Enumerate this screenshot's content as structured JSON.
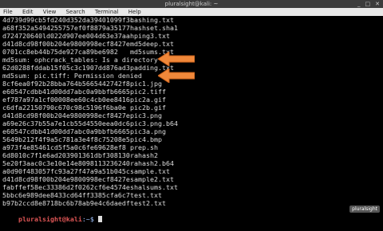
{
  "window": {
    "title": "pluralsight@kali: ~"
  },
  "menu": [
    "File",
    "Edit",
    "View",
    "Search",
    "Terminal",
    "Help"
  ],
  "lines": [
    {
      "sum": "4d739d99cb5fd240d352da39401099f3c",
      "file": "hashing.txt"
    },
    {
      "sum": "a68f352a5494255757ef0f8879a35177",
      "file": "hashset.sha1"
    },
    {
      "sum": "d724720640ld022d907ee004d63e37aa",
      "file": "hping3.txt"
    },
    {
      "sum": "d41d8cd98f00b204e9800998ecf8427e",
      "file": "md5deep.txt"
    },
    {
      "sum": "0701cc8eb44b75de927ca89be6982",
      "file": "md5sums.txt"
    },
    {
      "msg": "md5sum: ophcrack_tables: Is a directory"
    },
    {
      "sum": "62d0288fddab15f05c3c1907dd876ad3",
      "file": "padding.txt"
    },
    {
      "msg": "md5sum: pic.tiff: Permission denied"
    },
    {
      "sum": "8cf6ea0f92b28bba764b5665442742f8",
      "file": "pic1.jpg"
    },
    {
      "sum": "e60547cdbb41d00dd7abc0a9bbfb6665",
      "file": "pic2.tiff"
    },
    {
      "sum": "ef787a97a1cf00008ee60c4cb0ee8416",
      "file": "pic2a.gif"
    },
    {
      "sum": "c6dfa22150790c670c98c5196f6ba0e",
      "file": "pic2b.gif"
    },
    {
      "sum": "d41d8cd98f00b204e9800998ecf8427e",
      "file": "pic3.png"
    },
    {
      "sum": "a69e26c37b55a7e1cb55d4550eea0dc6",
      "file": "pic3.png.b64"
    },
    {
      "sum": "e60547cdbb41d00dd7abc0a9bbfb6665",
      "file": "pic3a.png"
    },
    {
      "sum": "5649b212f4f9a5c781a3e4f8c75208e5",
      "file": "pic4.bmp"
    },
    {
      "sum": "a973f4e85461cd5f5a0c6fe69628ef8",
      "file": "prep.sh"
    },
    {
      "sum": "6d8010c7f1e6ad203901361dbf308130",
      "file": "rahash2"
    },
    {
      "sum": "5e20f3aac0c3e10e14e8098113236240",
      "file": "rahash2.b64"
    },
    {
      "sum": "a0d90f483057fc93a27f47a9a51b045c",
      "file": "sample.txt"
    },
    {
      "sum": "d41d8cd98f00b204e9800998ecf8427e",
      "file": "sample2.txt"
    },
    {
      "sum": "fabffef58ec33386d2f0262cf6e4574e",
      "file": "shalsums.txt"
    },
    {
      "sum": "5bbc6e989dee8433cd64ff3385cfa6c7",
      "file": "test.txt"
    },
    {
      "sum": "b97b2ccd8e8718bc6b78ab9e4c6daedf",
      "file": "test2.txt"
    }
  ],
  "prompt": {
    "user": "pluralsight@kali",
    "sep": ":~$ "
  },
  "watermark": "pluralsight",
  "colors": {
    "arrow": "#f0883a",
    "terminal_bg": "#000000",
    "text": "#dddddd",
    "prompt_user": "#dd5555"
  }
}
